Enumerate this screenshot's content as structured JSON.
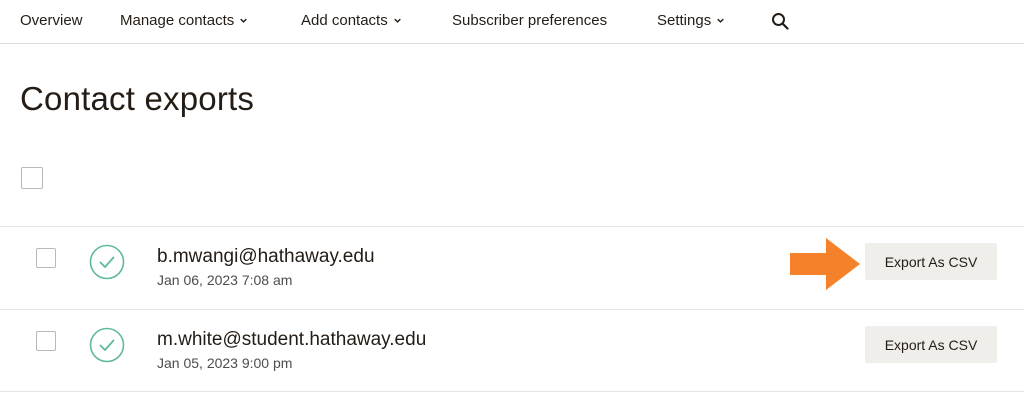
{
  "nav": {
    "items": [
      {
        "label": "Overview",
        "dropdown": false
      },
      {
        "label": "Manage contacts",
        "dropdown": true
      },
      {
        "label": "Add contacts",
        "dropdown": true
      },
      {
        "label": "Subscriber preferences",
        "dropdown": false
      },
      {
        "label": "Settings",
        "dropdown": true
      }
    ],
    "search_icon": "search-icon"
  },
  "page": {
    "title": "Contact exports"
  },
  "exports": [
    {
      "email": "b.mwangi@hathaway.edu",
      "date": "Jan 06, 2023 7:08 am",
      "status": "complete",
      "action_label": "Export As CSV"
    },
    {
      "email": "m.white@student.hathaway.edu",
      "date": "Jan 05, 2023 9:00 pm",
      "status": "complete",
      "action_label": "Export As CSV"
    }
  ],
  "colors": {
    "text": "#241c15",
    "status_green": "#5fb8a0",
    "button_bg": "#efeeea",
    "annotation_arrow": "#f5822b"
  },
  "annotation": {
    "icon": "arrow-right-icon"
  }
}
